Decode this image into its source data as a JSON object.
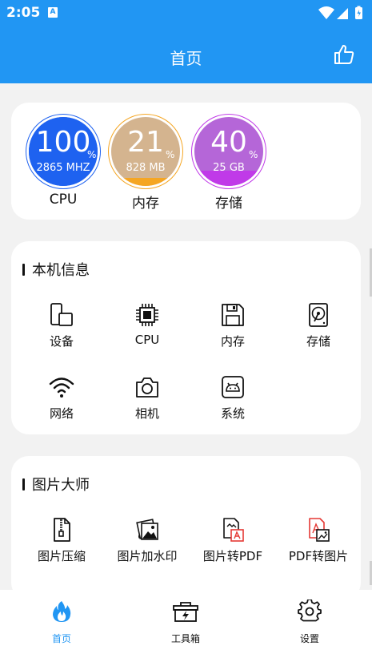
{
  "status_bar": {
    "time": "2:05",
    "sim_label": "A"
  },
  "app_bar": {
    "title": "首页",
    "action_icon": "thumbs-up-icon"
  },
  "gauges": [
    {
      "name": "CPU",
      "percent": "100",
      "percent_sign": "%",
      "detail": "2865 MHZ",
      "level": 1.0,
      "color": "#1e62f0",
      "fill_color": "#1e62f0",
      "ring_color": "#1e62f0"
    },
    {
      "name": "内存",
      "percent": "21",
      "percent_sign": "%",
      "detail": "828 MB",
      "level": 0.21,
      "color": "#d4b48f",
      "fill_color": "#f5a623",
      "ring_color": "#f5a623"
    },
    {
      "name": "存储",
      "percent": "40",
      "percent_sign": "%",
      "detail": "25 GB",
      "level": 0.4,
      "color": "#b566d8",
      "fill_color": "#c03ae8",
      "ring_color": "#c03ae8"
    }
  ],
  "device_info": {
    "title": "本机信息",
    "items": [
      {
        "label": "设备",
        "icon": "device-icon"
      },
      {
        "label": "CPU",
        "icon": "chip-icon"
      },
      {
        "label": "内存",
        "icon": "floppy-disk-icon"
      },
      {
        "label": "存储",
        "icon": "hard-drive-icon"
      },
      {
        "label": "网络",
        "icon": "wifi-icon"
      },
      {
        "label": "相机",
        "icon": "camera-icon"
      },
      {
        "label": "系统",
        "icon": "android-icon"
      }
    ]
  },
  "image_master": {
    "title": "图片大师",
    "items": [
      {
        "label": "图片压缩",
        "icon": "zip-file-icon"
      },
      {
        "label": "图片加水印",
        "icon": "watermark-image-icon"
      },
      {
        "label": "图片转PDF",
        "icon": "image-to-pdf-icon"
      },
      {
        "label": "PDF转图片",
        "icon": "pdf-to-image-icon"
      }
    ]
  },
  "bottom_nav": [
    {
      "label": "首页",
      "icon": "flame-icon",
      "active": true
    },
    {
      "label": "工具箱",
      "icon": "toolbox-icon",
      "active": false
    },
    {
      "label": "设置",
      "icon": "gear-icon",
      "active": false
    }
  ],
  "colors": {
    "primary": "#2196f3",
    "background": "#f2f2f2",
    "card": "#ffffff",
    "pdf_red": "#e53935"
  }
}
